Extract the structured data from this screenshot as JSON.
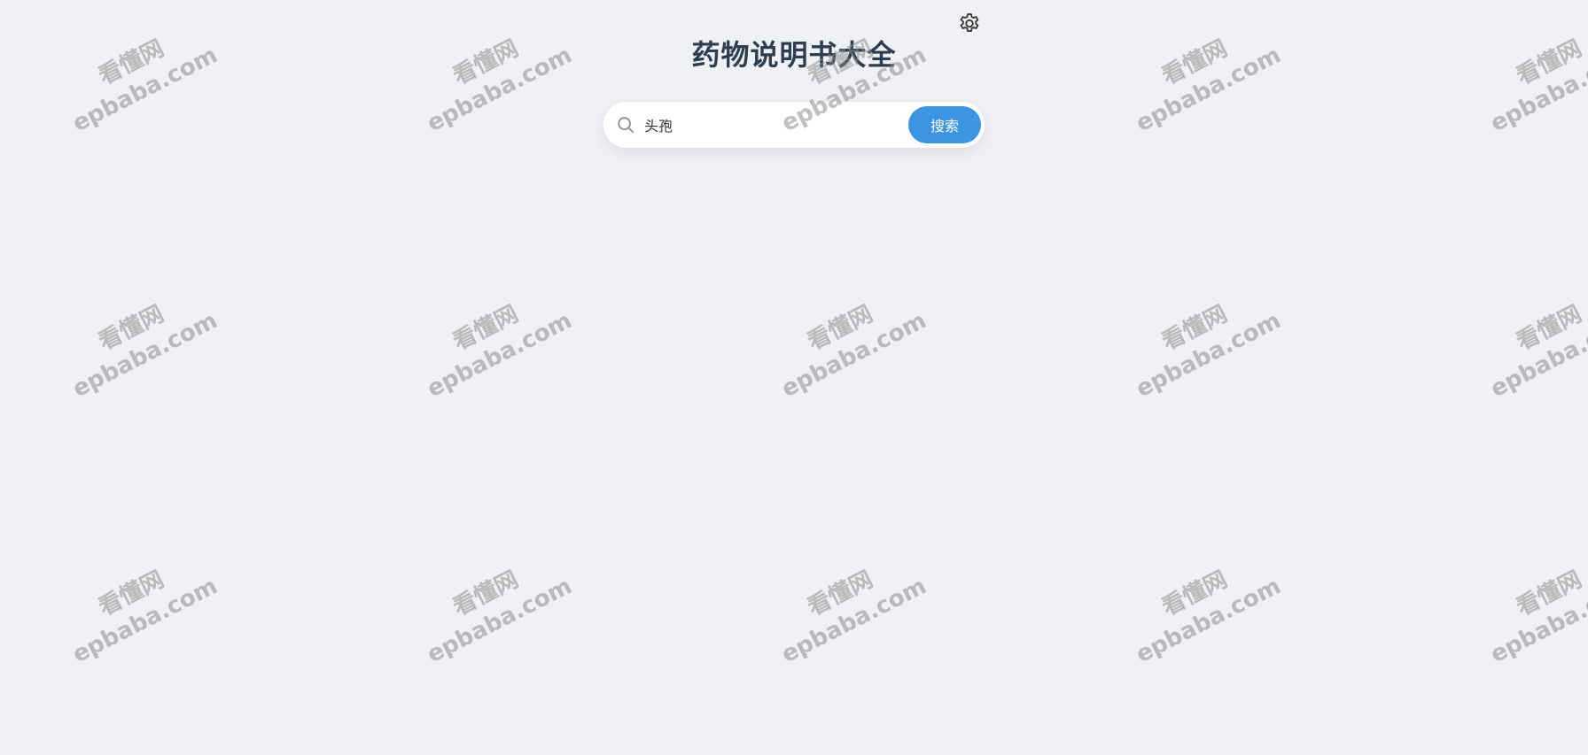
{
  "page": {
    "title": "药物说明书大全"
  },
  "toolbar": {
    "settings_icon": "gear-icon"
  },
  "search": {
    "icon": "search-icon",
    "value": "头孢",
    "button_label": "搜索"
  },
  "watermark": {
    "line1": "看懂网",
    "line2": "epbaba.com"
  },
  "colors": {
    "background": "#eff1f4",
    "title": "#2c3e50",
    "accent": "#3d94e0",
    "watermark": "#8c8c8c"
  }
}
